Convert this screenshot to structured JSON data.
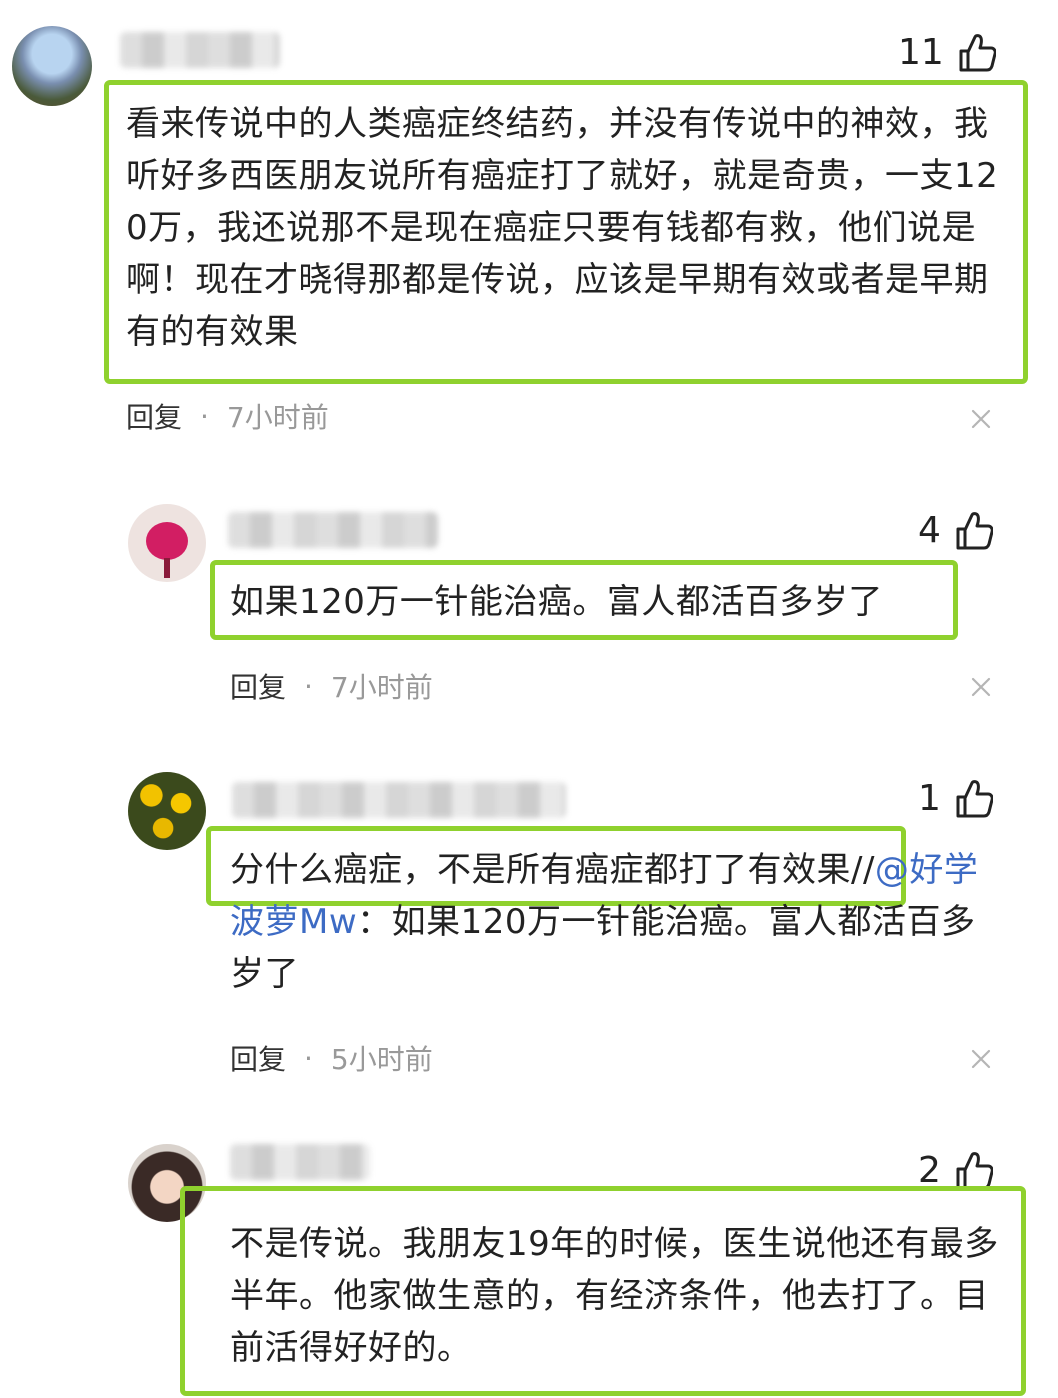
{
  "comments": [
    {
      "likes": "11",
      "text": "看来传说中的人类癌症终结药，并没有传说中的神效，我听好多西医朋友说所有癌症打了就好，就是奇贵，一支120万，我还说那不是现在癌症只要有钱都有救，他们说是啊！现在才晓得那都是传说，应该是早期有效或者是早期有的有效果",
      "reply_label": "回复",
      "time": "7小时前"
    },
    {
      "likes": "4",
      "text": "如果120万一针能治癌。富人都活百多岁了",
      "reply_label": "回复",
      "time": "7小时前"
    },
    {
      "likes": "1",
      "text_main": "分什么癌症，不是所有癌症都打了有效果//",
      "mention": "@好学波萝Mw",
      "text_quote": "：如果120万一针能治癌。富人都活百多岁了",
      "reply_label": "回复",
      "time": "5小时前"
    },
    {
      "likes": "2",
      "text": "不是传说。我朋友19年的时候，医生说他还有最多半年。他家做生意的，有经济条件，他去打了。目前活得好好的。"
    }
  ],
  "colors": {
    "highlight": "#8fd12e",
    "mention": "#3d6bc4",
    "muted": "#999999"
  },
  "icons": [
    "thumbs-up-icon",
    "close-icon"
  ]
}
